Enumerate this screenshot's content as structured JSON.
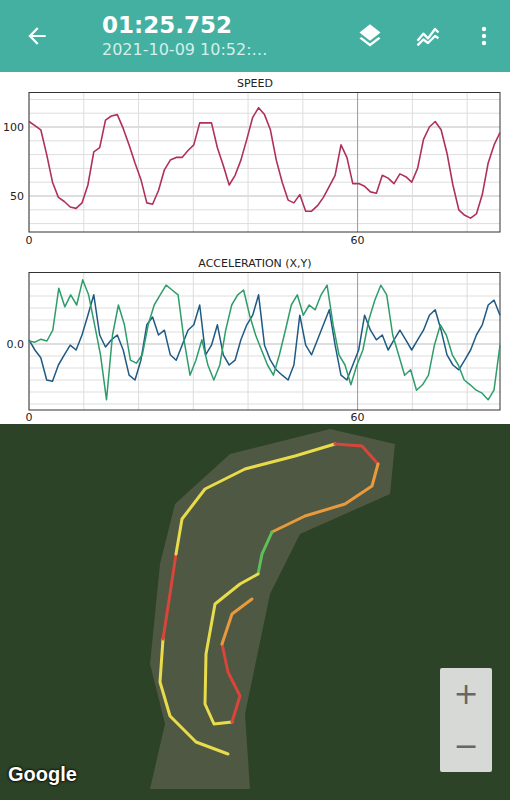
{
  "header": {
    "title": "01:25.752",
    "subtitle": "2021-10-09 10:52:…"
  },
  "speed_chart": {
    "title": "SPEED",
    "y_ticks": [
      {
        "label": "100",
        "value": 100
      },
      {
        "label": "50",
        "value": 50
      }
    ],
    "x_ticks": [
      {
        "label": "0",
        "value": 0
      },
      {
        "label": "60",
        "value": 60
      }
    ],
    "series": [
      {
        "color": "#b0305c",
        "values": [
          104,
          101,
          98,
          80,
          60,
          49,
          46,
          42,
          41,
          45,
          58,
          82,
          85,
          105,
          108,
          109,
          99,
          87,
          74,
          62,
          45,
          44,
          54,
          69,
          76,
          78,
          78,
          83,
          87,
          103,
          103,
          103,
          85,
          72,
          58,
          65,
          76,
          91,
          107,
          114,
          109,
          98,
          76,
          60,
          47,
          45,
          51,
          39,
          39,
          43,
          49,
          57,
          65,
          87,
          78,
          59,
          59,
          57,
          53,
          52,
          65,
          63,
          59,
          66,
          64,
          60,
          70,
          91,
          100,
          104,
          98,
          81,
          58,
          40,
          36,
          34,
          37,
          51,
          74,
          87,
          96
        ]
      }
    ]
  },
  "acceleration_chart": {
    "title": "ACCELERATION (X,Y)",
    "y_ticks": [
      {
        "label": "0.0",
        "value": 0
      }
    ],
    "x_ticks": [
      {
        "label": "0",
        "value": 0
      },
      {
        "label": "60",
        "value": 60
      }
    ],
    "series": [
      {
        "color": "#1f5a85",
        "values": [
          0.07,
          -0.1,
          -0.23,
          -0.6,
          -0.62,
          -0.35,
          -0.18,
          -0.02,
          -0.1,
          0.15,
          0.48,
          0.82,
          0.15,
          -0.05,
          0.07,
          0.15,
          -0.1,
          -0.52,
          -0.6,
          -0.27,
          0.32,
          0.45,
          0.15,
          0.23,
          -0.18,
          -0.27,
          -0.02,
          0.23,
          0.32,
          0.65,
          -0.18,
          -0.02,
          0.32,
          -0.18,
          -0.35,
          -0.27,
          0.07,
          0.32,
          0.48,
          0.82,
          -0.02,
          -0.27,
          -0.43,
          -0.52,
          -0.6,
          -0.35,
          0.48,
          -0.02,
          -0.18,
          0.07,
          0.32,
          0.57,
          -0.02,
          -0.52,
          -0.6,
          -0.35,
          -0.1,
          0.48,
          0.23,
          0.07,
          0.15,
          -0.1,
          0.07,
          0.23,
          0.07,
          -0.1,
          0.07,
          0.23,
          0.48,
          0.57,
          0.23,
          -0.18,
          -0.35,
          -0.43,
          -0.27,
          -0.1,
          0.15,
          0.32,
          0.65,
          0.73,
          0.48
        ]
      },
      {
        "color": "#2e9d6b",
        "values": [
          0.05,
          0.03,
          0.08,
          0.05,
          0.23,
          0.93,
          0.62,
          0.82,
          0.65,
          1.07,
          0.82,
          0.32,
          -0.18,
          -0.93,
          0.15,
          0.65,
          0.32,
          -0.27,
          -0.32,
          -0.18,
          0.32,
          0.65,
          0.82,
          0.98,
          0.9,
          0.82,
          0.07,
          -0.52,
          -0.27,
          0.07,
          -0.35,
          -0.6,
          -0.35,
          0.23,
          0.65,
          0.82,
          0.9,
          0.48,
          0.15,
          -0.1,
          -0.35,
          -0.52,
          -0.18,
          0.23,
          0.65,
          0.82,
          0.48,
          0.65,
          0.57,
          0.82,
          0.98,
          0.32,
          -0.18,
          -0.35,
          -0.68,
          -0.35,
          -0.1,
          0.4,
          0.73,
          0.98,
          0.82,
          0.15,
          -0.18,
          -0.52,
          -0.43,
          -0.77,
          -0.68,
          -0.52,
          -0.02,
          0.32,
          0.15,
          -0.18,
          -0.35,
          -0.6,
          -0.68,
          -0.77,
          -0.82,
          -0.93,
          -0.77,
          -0.02
        ]
      }
    ]
  },
  "map": {
    "attribution": "Google",
    "zoom_in": "+",
    "zoom_out": "−",
    "track": [
      {
        "color": "#e8dc4c",
        "points": [
          [
            228,
            330
          ],
          [
            196,
            318
          ],
          [
            170,
            292
          ],
          [
            160,
            258
          ],
          [
            163,
            215
          ]
        ]
      },
      {
        "color": "#d8453a",
        "points": [
          [
            163,
            215
          ],
          [
            170,
            170
          ],
          [
            176,
            130
          ]
        ]
      },
      {
        "color": "#e8dc4c",
        "points": [
          [
            176,
            130
          ],
          [
            182,
            95
          ],
          [
            205,
            65
          ],
          [
            245,
            45
          ],
          [
            295,
            32
          ],
          [
            335,
            20
          ]
        ]
      },
      {
        "color": "#d8453a",
        "points": [
          [
            335,
            20
          ],
          [
            362,
            22
          ],
          [
            378,
            40
          ]
        ]
      },
      {
        "color": "#e89a3c",
        "points": [
          [
            378,
            40
          ],
          [
            372,
            62
          ],
          [
            345,
            80
          ],
          [
            305,
            92
          ],
          [
            272,
            108
          ]
        ]
      },
      {
        "color": "#5fbf5a",
        "points": [
          [
            272,
            108
          ],
          [
            262,
            130
          ],
          [
            258,
            150
          ]
        ]
      },
      {
        "color": "#e8dc4c",
        "points": [
          [
            258,
            150
          ],
          [
            240,
            160
          ],
          [
            215,
            180
          ],
          [
            206,
            230
          ],
          [
            205,
            280
          ],
          [
            214,
            300
          ],
          [
            232,
            298
          ]
        ]
      },
      {
        "color": "#d8453a",
        "points": [
          [
            232,
            298
          ],
          [
            240,
            272
          ],
          [
            228,
            248
          ],
          [
            222,
            220
          ]
        ]
      },
      {
        "color": "#e89a3c",
        "points": [
          [
            222,
            220
          ],
          [
            232,
            190
          ],
          [
            252,
            175
          ]
        ]
      }
    ]
  }
}
